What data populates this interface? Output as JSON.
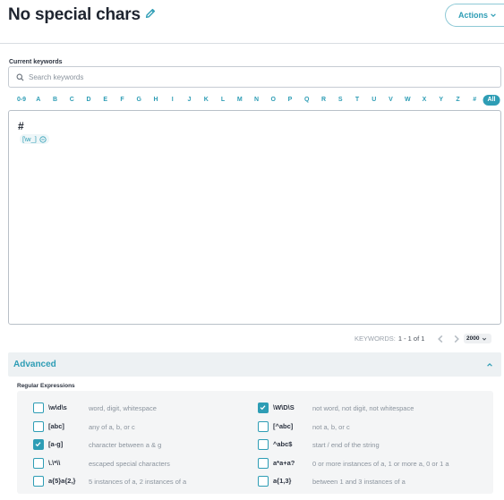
{
  "header": {
    "title": "No special chars",
    "edit_icon": "pencil-icon",
    "actions_label": "Actions"
  },
  "keywords": {
    "label": "Current keywords",
    "search_placeholder": "Search keywords",
    "search_value": ""
  },
  "alphabet": [
    "0-9",
    "A",
    "B",
    "C",
    "D",
    "E",
    "F",
    "G",
    "H",
    "I",
    "J",
    "K",
    "L",
    "M",
    "N",
    "O",
    "P",
    "Q",
    "R",
    "S",
    "T",
    "U",
    "V",
    "W",
    "X",
    "Y",
    "Z",
    "#",
    "All"
  ],
  "alphabet_selected": "All",
  "keyword_panel": {
    "group_heading": "#",
    "chip_text": "[\\w_]",
    "chip_icon": "remove-circle-icon"
  },
  "pagination": {
    "label": "KEYWORDS:",
    "range": "1 - 1 of 1",
    "page_size": "2000"
  },
  "advanced": {
    "title": "Advanced",
    "expanded": true,
    "regex_label": "Regular Expressions",
    "regex_items": [
      {
        "code": "\\w\\d\\s",
        "desc": "word, digit, whitespace",
        "checked": false
      },
      {
        "code": "\\W\\D\\S",
        "desc": "not word, not digit, not whitespace",
        "checked": true
      },
      {
        "code": "[abc]",
        "desc": "any of a, b, or c",
        "checked": false
      },
      {
        "code": "[^abc]",
        "desc": "not a, b, or c",
        "checked": false
      },
      {
        "code": "[a-g]",
        "desc": "character between a & g",
        "checked": true
      },
      {
        "code": "^abc$",
        "desc": "start / end of the string",
        "checked": false
      },
      {
        "code": "\\.\\*\\\\",
        "desc": "escaped special characters",
        "checked": false
      },
      {
        "code": "a*a+a?",
        "desc": "0 or more instances of a, 1 or more a, 0 or 1 a",
        "checked": false
      },
      {
        "code": "a{5}a{2,}",
        "desc": "5 instances of a, 2 instances of a",
        "checked": false
      },
      {
        "code": "a{1,3}",
        "desc": "between 1 and 3 instances of a",
        "checked": false
      }
    ]
  },
  "colors": {
    "accent": "#2e9db5",
    "text": "#2c3340",
    "muted": "#8a939d",
    "panel_bg": "#f4f5f6"
  }
}
